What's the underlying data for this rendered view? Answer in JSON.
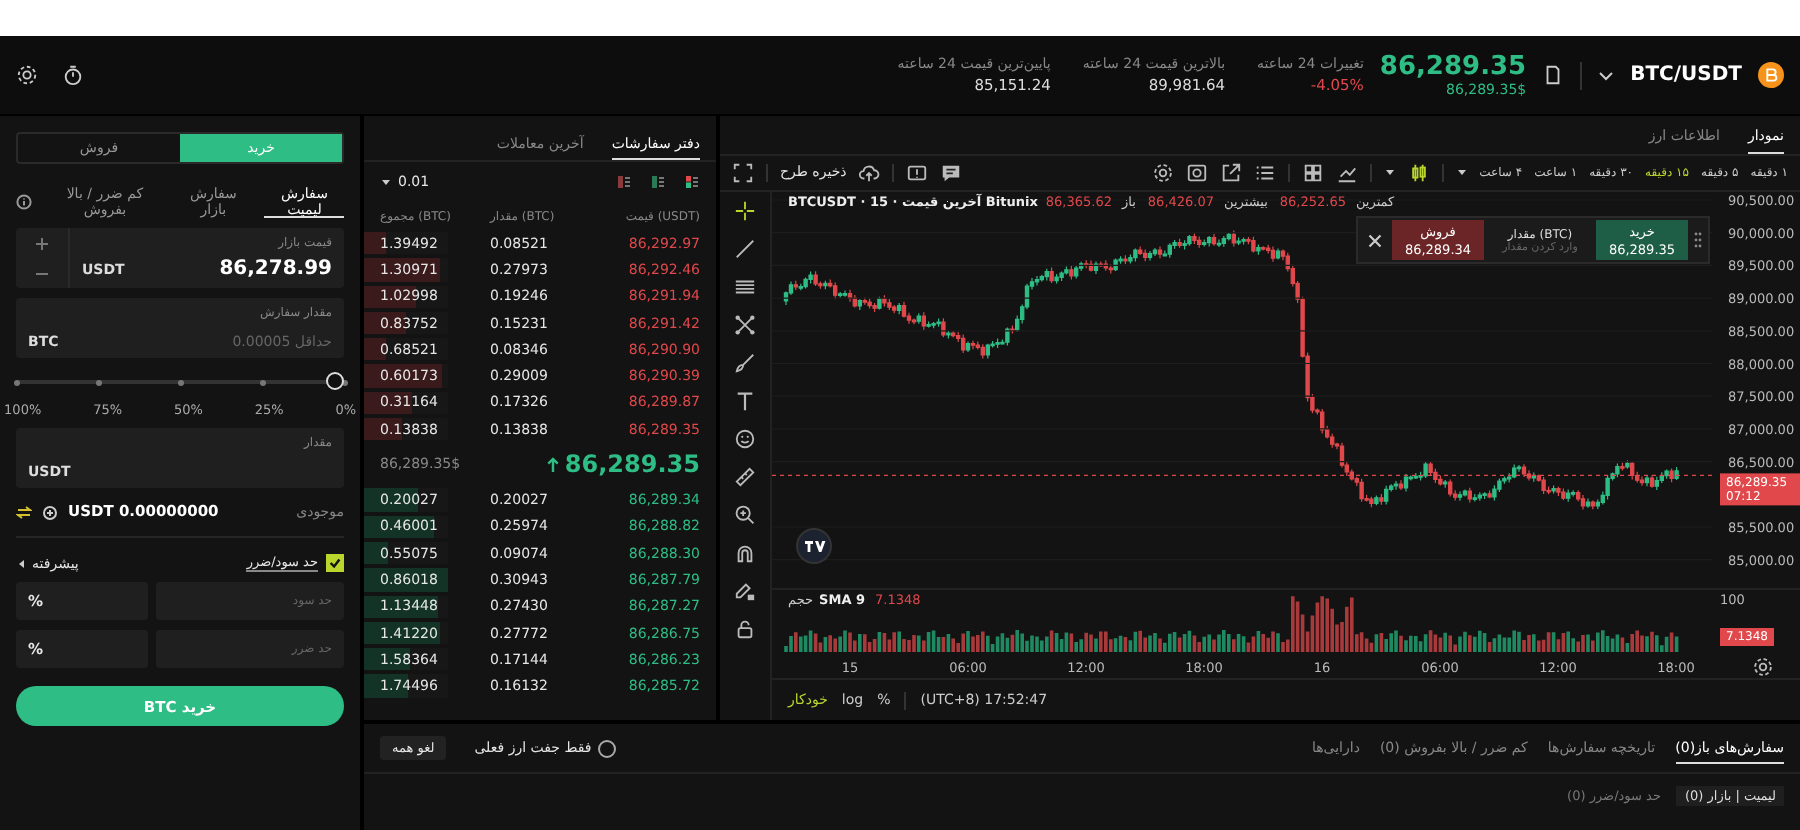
{
  "top_bar": {
    "pair": "BTC/USDT",
    "last_price": "86,289.35",
    "last_price_usd": "86,289.35$",
    "stats": [
      {
        "label": "تغییرات 24 ساعته",
        "value": "-4.05%",
        "kind": "down"
      },
      {
        "label": "بالاترین قیمت 24 ساعته",
        "value": "89,981.64",
        "kind": "plain"
      },
      {
        "label": "پایین‌ترین قیمت 24 ساعته",
        "value": "85,151.24",
        "kind": "plain"
      }
    ]
  },
  "order_form": {
    "sides": [
      {
        "label": "خرید",
        "selected": true
      },
      {
        "label": "فروش",
        "selected": false
      }
    ],
    "order_types": [
      {
        "label": "سفارش لیمیت",
        "selected": true
      },
      {
        "label": "سفارش بازار",
        "selected": false
      },
      {
        "label": "کم ضرر / بالا بفروش",
        "selected": false
      }
    ],
    "price_field": {
      "label": "قیمت بازار",
      "value": "86,278.99",
      "unit": "USDT"
    },
    "amount_field": {
      "label": "مقدار سفارش",
      "placeholder": "حداقل 0.00005",
      "unit": "BTC"
    },
    "slider": {
      "level": 0,
      "marks": [
        "0%",
        "25%",
        "50%",
        "75%",
        "100%"
      ]
    },
    "total_field": {
      "label": "مقدار",
      "unit": "USDT"
    },
    "balance": {
      "label": "موجودی",
      "value": "USDT 0.00000000"
    },
    "tp_sl": {
      "label": "حد سود/ضرر",
      "checked": true
    },
    "advanced": "پیشرفته",
    "tp_sl_fields": [
      {
        "placeholder": "حد سود",
        "unit": "%"
      },
      {
        "placeholder": "حد ضرر",
        "unit": "%"
      }
    ],
    "submit": "خرید BTC"
  },
  "order_book": {
    "tabs": [
      {
        "label": "دفتر سفارشات",
        "selected": true
      },
      {
        "label": "آخرین معاملات",
        "selected": false
      }
    ],
    "precision": "0.01",
    "columns": [
      "قیمت (USDT)",
      "مقدار (BTC)",
      "مجموع (BTC)"
    ],
    "asks": [
      {
        "price": "86,292.97",
        "amount": "0.08521",
        "total": "1.39492",
        "level": 0.27
      },
      {
        "price": "86,292.46",
        "amount": "0.27973",
        "total": "1.30971",
        "level": 0.9
      },
      {
        "price": "86,291.94",
        "amount": "0.19246",
        "total": "1.02998",
        "level": 0.62
      },
      {
        "price": "86,291.42",
        "amount": "0.15231",
        "total": "0.83752",
        "level": 0.49
      },
      {
        "price": "86,290.90",
        "amount": "0.08346",
        "total": "0.68521",
        "level": 0.27
      },
      {
        "price": "86,290.39",
        "amount": "0.29009",
        "total": "0.60173",
        "level": 0.94
      },
      {
        "price": "86,289.87",
        "amount": "0.17326",
        "total": "0.31164",
        "level": 0.56
      },
      {
        "price": "86,289.35",
        "amount": "0.13838",
        "total": "0.13838",
        "level": 0.45
      }
    ],
    "last_price": "86,289.35",
    "last_price_usd": "86,289.35$",
    "bids": [
      {
        "price": "86,289.34",
        "amount": "0.20027",
        "total": "0.20027",
        "level": 0.65
      },
      {
        "price": "86,288.82",
        "amount": "0.25974",
        "total": "0.46001",
        "level": 0.84
      },
      {
        "price": "86,288.30",
        "amount": "0.09074",
        "total": "0.55075",
        "level": 0.29
      },
      {
        "price": "86,287.79",
        "amount": "0.30943",
        "total": "0.86018",
        "level": 1.0
      },
      {
        "price": "86,287.27",
        "amount": "0.27430",
        "total": "1.13448",
        "level": 0.88
      },
      {
        "price": "86,286.75",
        "amount": "0.27772",
        "total": "1.41220",
        "level": 0.9
      },
      {
        "price": "86,286.23",
        "amount": "0.17144",
        "total": "1.58364",
        "level": 0.55
      },
      {
        "price": "86,285.72",
        "amount": "0.16132",
        "total": "1.74496",
        "level": 0.52
      }
    ]
  },
  "chart": {
    "tabs": [
      {
        "label": "نمودار",
        "selected": true
      },
      {
        "label": "اطلاعات ارز",
        "selected": false
      }
    ],
    "intervals": [
      {
        "label": "۱ دقیقه",
        "selected": false
      },
      {
        "label": "۵ دقیقه",
        "selected": false
      },
      {
        "label": "۱۵ دقیقه",
        "selected": true
      },
      {
        "label": "۳۰ دقیقه",
        "selected": false
      },
      {
        "label": "۱ ساعت",
        "selected": false
      },
      {
        "label": "۴ ساعت",
        "selected": false
      }
    ],
    "save_layout": "ذخیره طرح",
    "legend": {
      "symbol": "BTCUSDT · 15 · آخرین قیمت Bitunix",
      "stats": [
        {
          "label": "کمترین",
          "value": "86,252.65"
        },
        {
          "label": "بیشترین",
          "value": "86,426.07"
        },
        {
          "label": "باز",
          "value": "86,365.62"
        }
      ]
    },
    "trade_widget": {
      "sell_label": "فروش",
      "sell_price": "86,289.34",
      "amount_label": "مقدار (BTC)",
      "amount_placeholder": "وارد کردن مقدار",
      "buy_label": "خرید",
      "buy_price": "86,289.35"
    },
    "price_axis": [
      "90,500.00",
      "90,000.00",
      "89,500.00",
      "89,000.00",
      "88,500.00",
      "88,000.00",
      "87,500.00",
      "87,000.00",
      "86,500.00",
      "85,500.00",
      "85,000.00"
    ],
    "price_tag": {
      "price": "86,289.35",
      "countdown": "07:12"
    },
    "volume_legend": {
      "label": "حجم",
      "indicator": "SMA 9",
      "value": "7.1348"
    },
    "volume_axis": "100",
    "volume_tag": "7.1348",
    "time_axis": [
      "18:00",
      "12:00",
      "06:00",
      "16",
      "18:00",
      "12:00",
      "06:00",
      "15"
    ],
    "footer": {
      "auto": "خودکار",
      "log": "log",
      "percent": "%",
      "time": "(UTC+8) 17:52:47"
    }
  },
  "bottom_panel": {
    "tabs": [
      {
        "label": "سفارش‌های باز(0)",
        "selected": true
      },
      {
        "label": "تاریخچه سفارش‌ها",
        "selected": false
      },
      {
        "label": "کم ضرر / بالا بفروش (0)",
        "selected": false
      },
      {
        "label": "دارایی‌ها",
        "selected": false
      }
    ],
    "filter": {
      "label": "فقط جفت ارز فعلی",
      "checked": false
    },
    "cancel_all": "لغو همه",
    "sub_tabs": [
      {
        "label": "لیمیت | بازار (0)",
        "selected": true
      },
      {
        "label": "حد سود/ضرر (0)",
        "selected": false
      }
    ]
  }
}
